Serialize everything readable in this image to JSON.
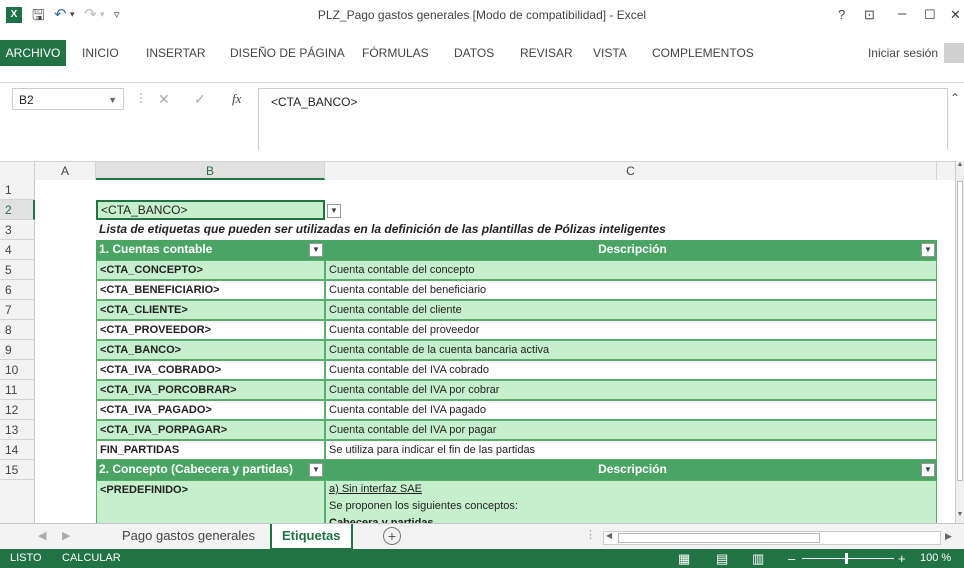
{
  "titlebar": {
    "title": "PLZ_Pago gastos generales  [Modo de compatibilidad] - Excel",
    "help": "?",
    "restore": "⊡",
    "minimize": "–",
    "maximize": "☐",
    "close": "✕"
  },
  "ribbon": {
    "tabs": [
      "ARCHIVO",
      "INICIO",
      "INSERTAR",
      "DISEÑO DE PÁGINA",
      "FÓRMULAS",
      "DATOS",
      "REVISAR",
      "VISTA",
      "COMPLEMENTOS"
    ],
    "signin": "Iniciar sesión"
  },
  "formula_bar": {
    "name_box": "B2",
    "content": "<CTA_BANCO>",
    "fx": "fx"
  },
  "columns": [
    "A",
    "B",
    "C"
  ],
  "rows": [
    "1",
    "2",
    "3",
    "4",
    "5",
    "6",
    "7",
    "8",
    "9",
    "10",
    "11",
    "12",
    "13",
    "14",
    "15"
  ],
  "cells": {
    "b2": "<CTA_BANCO>",
    "r3_title": "Lista de etiquetas que pueden ser utilizadas en la definición de las plantillas de Pólizas inteligentes",
    "h4_left": "1. Cuentas contable",
    "h4_right": "Descripción",
    "items": [
      {
        "tag": "<CTA_CONCEPTO>",
        "desc": "Cuenta contable del concepto"
      },
      {
        "tag": "<CTA_BENEFICIARIO>",
        "desc": "Cuenta contable del beneficiario"
      },
      {
        "tag": "<CTA_CLIENTE>",
        "desc": "Cuenta contable del cliente"
      },
      {
        "tag": "<CTA_PROVEEDOR>",
        "desc": "Cuenta contable del proveedor"
      },
      {
        "tag": "<CTA_BANCO>",
        "desc": "Cuenta contable de la cuenta bancaria activa"
      },
      {
        "tag": "<CTA_IVA_COBRADO>",
        "desc": "Cuenta contable del IVA cobrado"
      },
      {
        "tag": "<CTA_IVA_PORCOBRAR>",
        "desc": "Cuenta contable del IVA por cobrar"
      },
      {
        "tag": "<CTA_IVA_PAGADO>",
        "desc": "Cuenta contable del IVA pagado"
      },
      {
        "tag": "<CTA_IVA_PORPAGAR>",
        "desc": "Cuenta contable del IVA por pagar"
      },
      {
        "tag": "FIN_PARTIDAS",
        "desc": "Se utiliza para indicar el fin de las partidas"
      }
    ],
    "h15_left": "2. Concepto (Cabecera y partidas)",
    "h15_right": "Descripción",
    "r16_tag": "<PREDEFINIDO>",
    "r16_line1": "a) Sin interfaz SAE",
    "r16_line2": "Se proponen los siguientes conceptos:",
    "r16_line3": "Cabecera y partidas"
  },
  "sheets": {
    "inactive": "Pago gastos generales",
    "active": "Etiquetas"
  },
  "status": {
    "ready": "LISTO",
    "calc": "CALCULAR",
    "zoom": "100 %"
  },
  "colors": {
    "excel_green": "#217346",
    "header_green": "#4aa564",
    "row_green": "#c6efce"
  }
}
